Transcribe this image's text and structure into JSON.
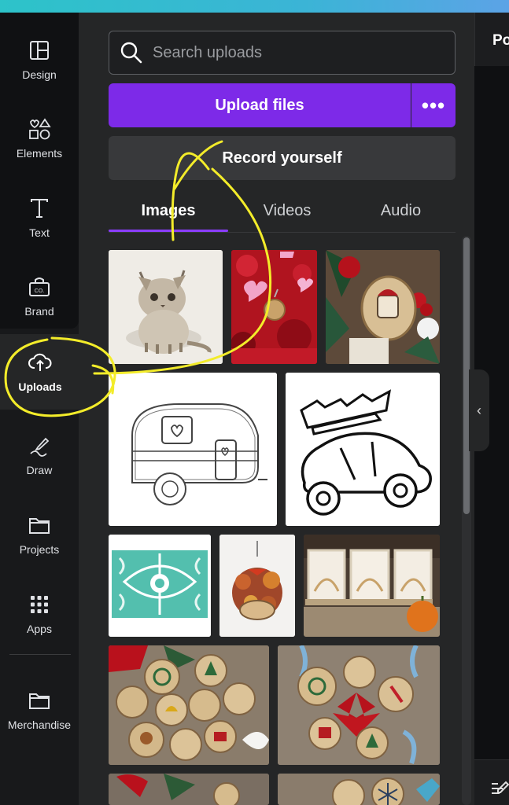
{
  "sidebar": {
    "items": [
      {
        "label": "Design",
        "icon": "layout-icon"
      },
      {
        "label": "Elements",
        "icon": "shapes-icon"
      },
      {
        "label": "Text",
        "icon": "text-icon"
      },
      {
        "label": "Brand",
        "icon": "brand-icon"
      },
      {
        "label": "Uploads",
        "icon": "cloud-upload-icon"
      },
      {
        "label": "Draw",
        "icon": "draw-icon"
      },
      {
        "label": "Projects",
        "icon": "folder-icon"
      },
      {
        "label": "Apps",
        "icon": "apps-grid-icon"
      },
      {
        "label": "Merchandise",
        "icon": "folder-icon"
      }
    ],
    "brand_badge": "CO."
  },
  "search": {
    "placeholder": "Search uploads",
    "value": ""
  },
  "actions": {
    "upload_label": "Upload files",
    "more_label": "•••",
    "record_label": "Record yourself"
  },
  "tabs": [
    {
      "label": "Images",
      "active": true
    },
    {
      "label": "Videos",
      "active": false
    },
    {
      "label": "Audio",
      "active": false
    }
  ],
  "right_panel": {
    "title_fragment": "Po",
    "collapse_glyph": "‹"
  },
  "uploads": [
    "kitten sketch",
    "red valentine hearts keychain",
    "wood slice christmas ornament",
    "camper line drawing",
    "car with christmas tree line drawing",
    "teal folk floral pattern",
    "autumn door wreath",
    "shadow box frames with pumpkin",
    "wood slice ornaments set",
    "wood slice poinsettia wreath",
    "red ornaments partial",
    "snowflake wood slices partial"
  ],
  "colors": {
    "accent": "#7d2ae8",
    "tab_underline": "#8b3dff",
    "annotation": "#f3ec2a",
    "panel": "#252627"
  }
}
